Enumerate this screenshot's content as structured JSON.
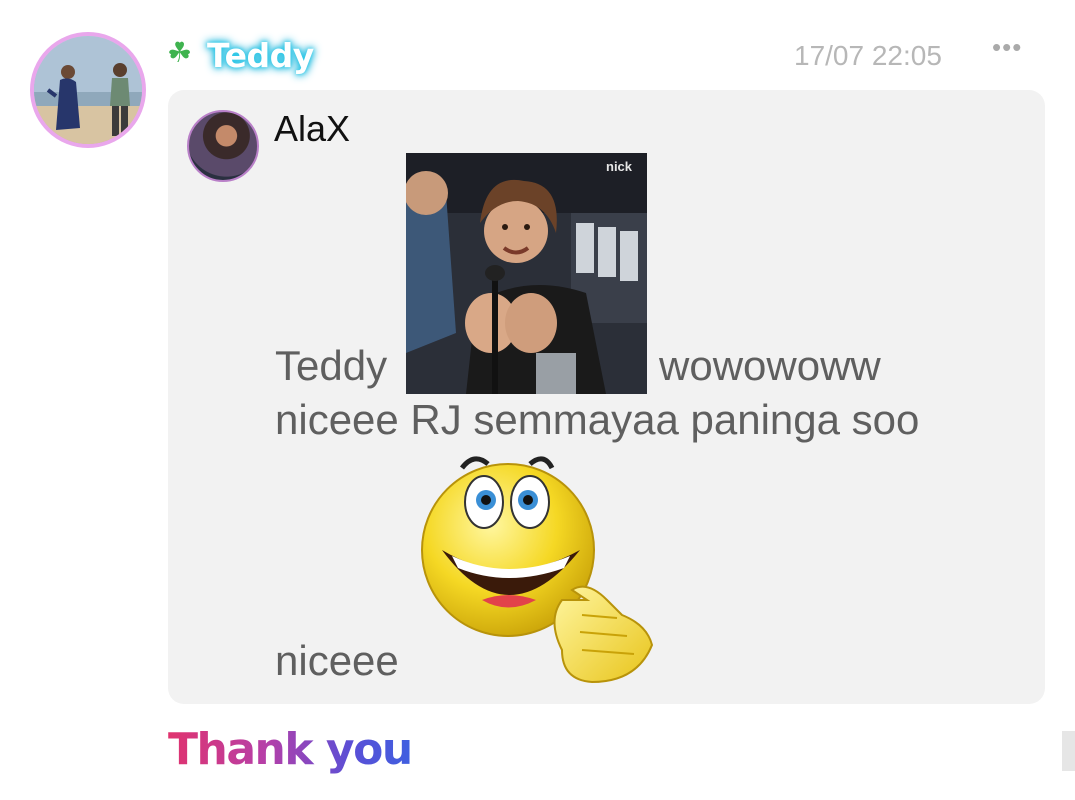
{
  "message": {
    "sender": {
      "name": "Teddy",
      "icon": "four-leaf-clover-icon"
    },
    "timestamp": "17/07 22:05",
    "more_label": "•••",
    "quoted": {
      "author": "AlaX",
      "text_before_gif": "Teddy",
      "text_after_gif": "wowowoww",
      "line_two": "niceee RJ semmayaa paninga soo",
      "line_three": "niceee",
      "gif_watermark": "nick"
    },
    "reply_text": "Thank you"
  },
  "colors": {
    "bubble_bg": "#f2f2f2",
    "avatar_ring": "#e9a7ec",
    "name_glow": "#28c8e8",
    "timestamp": "#b7b7b7",
    "message_text": "#5f5f5f",
    "reply_gradient": [
      "#e0336e",
      "#b63fa8",
      "#3f5fe0"
    ]
  }
}
